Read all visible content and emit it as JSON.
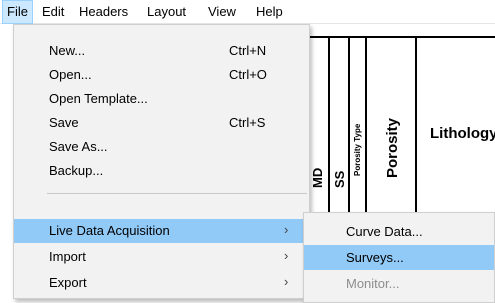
{
  "menubar": {
    "items": [
      "File",
      "Edit",
      "Headers",
      "Layout",
      "View",
      "Help"
    ]
  },
  "file_menu": {
    "items": [
      {
        "label": "New...",
        "shortcut": "Ctrl+N"
      },
      {
        "label": "Open...",
        "shortcut": "Ctrl+O"
      },
      {
        "label": "Open Template...",
        "shortcut": ""
      },
      {
        "label": "Save",
        "shortcut": "Ctrl+S"
      },
      {
        "label": "Save As...",
        "shortcut": ""
      },
      {
        "label": "Backup...",
        "shortcut": ""
      },
      {
        "label": "Live Data Acquisition",
        "submenu_arrow": "›"
      },
      {
        "label": "Import",
        "submenu_arrow": "›"
      },
      {
        "label": "Export",
        "submenu_arrow": "›"
      }
    ]
  },
  "live_data_submenu": {
    "items": [
      {
        "label": "Curve Data...",
        "enabled": true
      },
      {
        "label": "Surveys...",
        "enabled": true
      },
      {
        "label": "Monitor...",
        "enabled": false
      }
    ]
  },
  "log_header": {
    "columns": [
      "MD",
      "SS",
      "Porosity Type",
      "Porosity",
      "Lithology"
    ],
    "porosity_scale": [
      "%",
      "%",
      "%",
      "%"
    ]
  }
}
